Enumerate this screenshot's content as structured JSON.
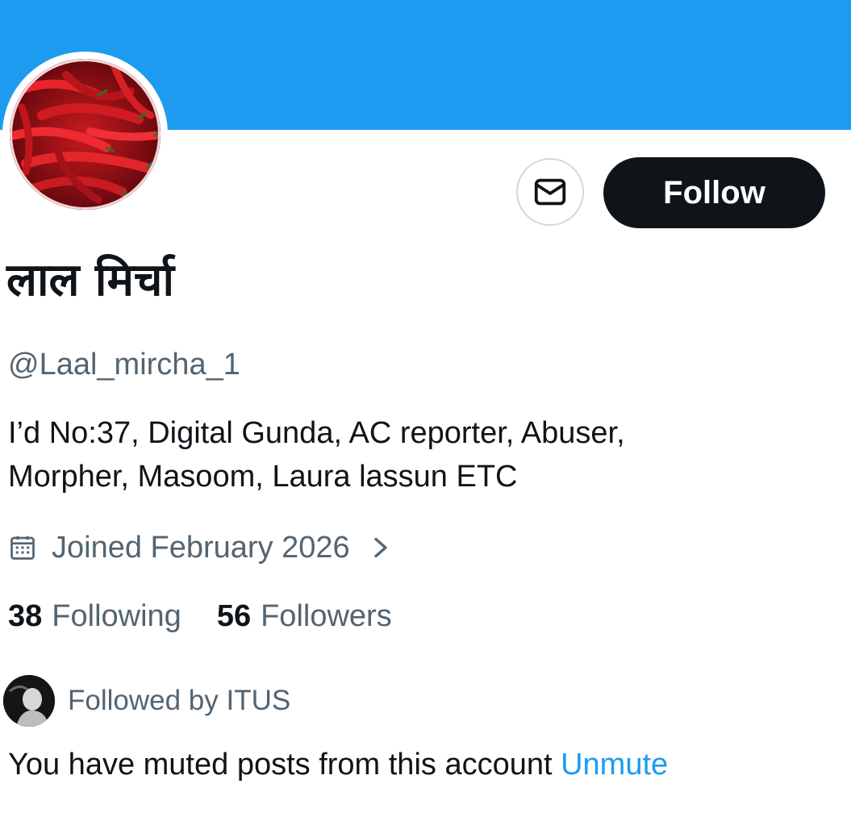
{
  "profile": {
    "display_name": "लाल मिर्चा",
    "handle": "@Laal_mircha_1",
    "bio_lines": [
      "I’d No:37, Digital Gunda, AC reporter, Abuser,",
      "Morpher, Masoom, Laura lassun ETC"
    ],
    "joined": "Joined February 2026",
    "joined_icon": "calendar-icon",
    "joined_chevron_icon": "chevron-right-icon"
  },
  "actions": {
    "message_icon": "envelope-icon",
    "follow_label": "Follow"
  },
  "stats": {
    "following_count": "38",
    "following_label": "Following",
    "followers_count": "56",
    "followers_label": "Followers"
  },
  "followed_by": {
    "text": "Followed by ITUS"
  },
  "muted": {
    "message": "You have muted posts from this account",
    "unmute_label": "Unmute"
  },
  "colors": {
    "banner": "#1d9bf0",
    "follow_button_bg": "#0f1419",
    "secondary_text": "#536471",
    "link": "#1d9bf0"
  }
}
